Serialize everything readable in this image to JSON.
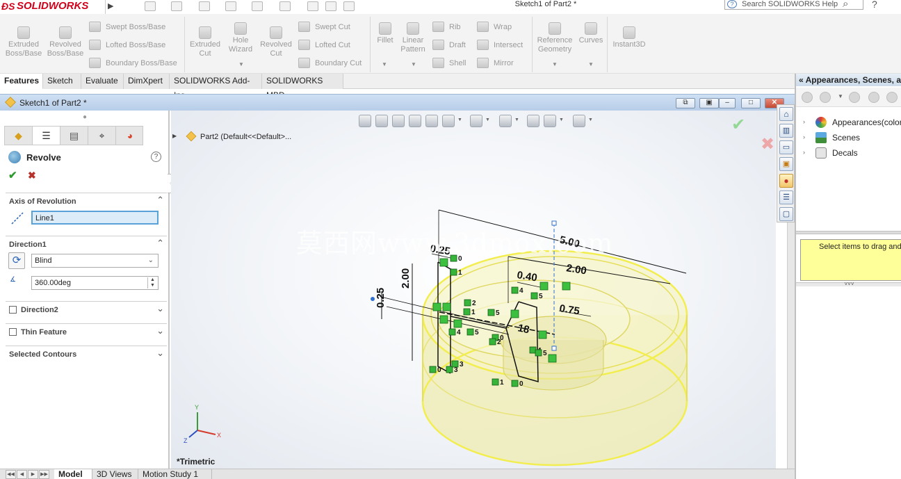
{
  "app": {
    "logo_text": "SOLIDWORKS",
    "document_title": "Sketch1 of Part2 *",
    "search_placeholder": "Search SOLIDWORKS Help",
    "help_label": "?"
  },
  "command_manager": {
    "large": [
      {
        "label": "Extruded Boss/Base",
        "icon": "extruded-boss-icon"
      },
      {
        "label": "Revolved Boss/Base",
        "icon": "revolved-boss-icon"
      },
      {
        "label": "Extruded Cut",
        "icon": "extruded-cut-icon"
      },
      {
        "label": "Hole Wizard",
        "icon": "hole-wizard-icon"
      },
      {
        "label": "Revolved Cut",
        "icon": "revolved-cut-icon"
      },
      {
        "label": "Fillet",
        "icon": "fillet-icon"
      },
      {
        "label": "Linear Pattern",
        "icon": "linear-pattern-icon"
      },
      {
        "label": "Reference Geometry",
        "icon": "reference-geometry-icon"
      },
      {
        "label": "Curves",
        "icon": "curves-icon"
      },
      {
        "label": "Instant3D",
        "icon": "instant3d-icon"
      }
    ],
    "small": [
      {
        "label": "Swept Boss/Base"
      },
      {
        "label": "Lofted Boss/Base"
      },
      {
        "label": "Boundary Boss/Base"
      },
      {
        "label": "Swept Cut"
      },
      {
        "label": "Lofted Cut"
      },
      {
        "label": "Boundary Cut"
      },
      {
        "label": "Rib"
      },
      {
        "label": "Draft"
      },
      {
        "label": "Shell"
      },
      {
        "label": "Wrap"
      },
      {
        "label": "Intersect"
      },
      {
        "label": "Mirror"
      }
    ]
  },
  "tabs": [
    "Features",
    "Sketch",
    "Evaluate",
    "DimXpert",
    "SOLIDWORKS Add-Ins",
    "SOLIDWORKS MBD"
  ],
  "active_tab": "Features",
  "doc_window": {
    "title": "Sketch1 of Part2 *",
    "buttons": [
      "restore",
      "tile",
      "minimize",
      "maximize",
      "close"
    ]
  },
  "property_manager": {
    "feature_name": "Revolve",
    "help": "?",
    "ok": "✔",
    "cancel": "✖",
    "axis_group": {
      "title": "Axis of Revolution",
      "value": "Line1"
    },
    "direction1_group": {
      "title": "Direction1",
      "end_condition": "Blind",
      "angle": "360.00deg"
    },
    "direction2_group": {
      "title": "Direction2",
      "checked": false
    },
    "thin_group": {
      "title": "Thin Feature",
      "checked": false
    },
    "contours_group": {
      "title": "Selected Contours"
    }
  },
  "graphics": {
    "tree_part": "Part2  (Default<<Default>...",
    "view_name": "*Trimetric",
    "watermark": "莫西网www.3dmox.com",
    "dimensions": [
      "5.00",
      "2.00",
      "0.40",
      "0.75",
      "0.25",
      "2.00",
      "0.25",
      "18"
    ],
    "relation_numbers": [
      "0",
      "1",
      "2",
      "5",
      "4",
      "5",
      "0",
      "2",
      "3",
      "3",
      "0",
      "1",
      "0",
      "4",
      "5",
      "4",
      "5",
      "1"
    ],
    "triad": {
      "x": "X",
      "y": "Y",
      "z": "Z"
    },
    "colors": {
      "body": "#f3f1a8",
      "edge": "#f2ef55",
      "sketch": "#111111",
      "relation": "#2fae2f",
      "axis": "#2f6fd0"
    }
  },
  "bottom_tabs": [
    "Model",
    "3D Views",
    "Motion Study 1"
  ],
  "active_bottom_tab": "Model",
  "task_pane": {
    "title": "Appearances, Scenes, and Decals",
    "items": [
      {
        "label": "Appearances(color)",
        "icon": "appearances-icon"
      },
      {
        "label": "Scenes",
        "icon": "scenes-icon"
      },
      {
        "label": "Decals",
        "icon": "decals-icon"
      }
    ],
    "message": "Select items to drag and drop"
  }
}
